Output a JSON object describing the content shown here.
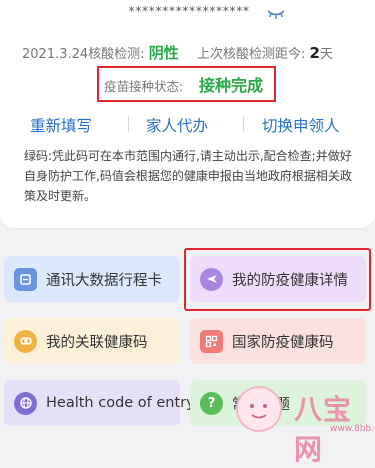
{
  "card": {
    "masked_id": "******************",
    "test_date_label": "2021.3.24核酸检测:",
    "test_result": "阴性",
    "last_test_label": "上次核酸检测距今:",
    "last_test_days": "2",
    "last_test_unit": "天",
    "vaccine_label": "疫苗接种状态:",
    "vaccine_status": "接种完成",
    "actions": [
      "重新填写",
      "家人代办",
      "切换申领人"
    ],
    "notice": "绿码:凭此码可在本市范围内通行,请主动出示,配合检查;并做好自身防护工作,码值会根据您的健康申报由当地政府根据相关政策及时更新。"
  },
  "tiles": [
    {
      "label": "通讯大数据行程卡",
      "icon": "phone-card-icon",
      "bg": "#dce8fb",
      "icon_bg": "#6b95de"
    },
    {
      "label": "我的防疫健康详情",
      "icon": "airplane-icon",
      "bg": "#eedcfa",
      "icon_bg": "#a984e0"
    },
    {
      "label": "我的关联健康码",
      "icon": "link-icon",
      "bg": "#fdf0d8",
      "icon_bg": "#f2b243"
    },
    {
      "label": "国家防疫健康码",
      "icon": "qr-code-icon",
      "bg": "#fbe0e0",
      "icon_bg": "#ee7a7a"
    },
    {
      "label": "Health code of entry",
      "icon": "globe-icon",
      "bg": "#e4e0f7",
      "icon_bg": "#7d6fd2"
    },
    {
      "label": "常见问题",
      "icon": "question-icon",
      "bg": "#def3dc",
      "icon_bg": "#5bbd5a"
    }
  ],
  "colors": {
    "accent_green": "#2aa84a",
    "link_blue": "#2a6fc9",
    "highlight_red": "#e0262b"
  },
  "watermark": {
    "text": "八宝网",
    "url": "www.8bb.com"
  }
}
